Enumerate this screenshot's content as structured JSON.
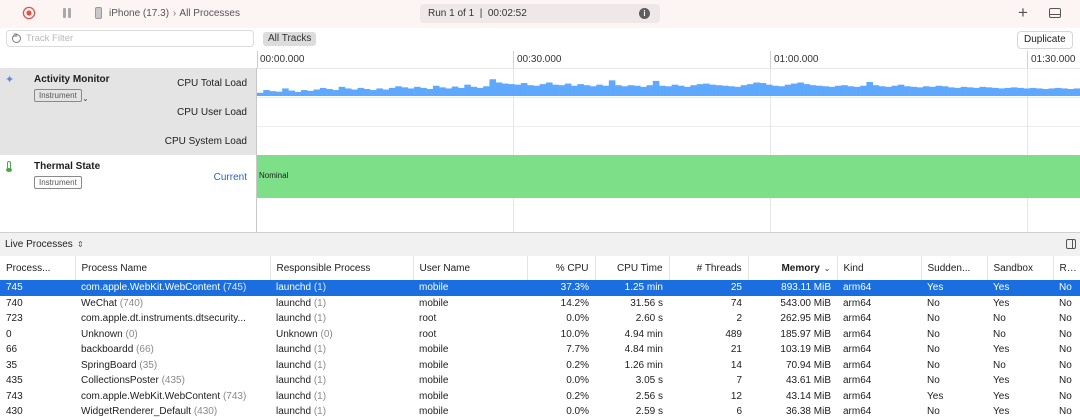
{
  "toolbar": {
    "device": "iPhone (17.3)",
    "separator": "›",
    "scope": "All Processes",
    "status": "Run 1 of 1  |  00:02:52",
    "info_icon": "info-icon",
    "plus_label": "+",
    "record_color": "#e0534b"
  },
  "filter": {
    "placeholder": "Track Filter",
    "value": "",
    "all_tracks": "All Tracks",
    "duplicate": "Duplicate"
  },
  "ruler": {
    "labels": [
      "00:00.000",
      "00:30.000",
      "01:00.000",
      "01:30.000"
    ]
  },
  "tracks": {
    "activity_monitor": {
      "title": "Activity Monitor",
      "tag": "Instrument",
      "lanes": [
        "CPU Total Load",
        "CPU User Load",
        "CPU System Load"
      ]
    },
    "thermal_state": {
      "title": "Thermal State",
      "tag": "Instrument",
      "current": "Current",
      "value": "Nominal",
      "color": "#7ddf88"
    }
  },
  "cpu_total_load": {
    "color": "#5ea8ff",
    "levels": [
      0.12,
      0.22,
      0.18,
      0.16,
      0.28,
      0.2,
      0.15,
      0.22,
      0.19,
      0.24,
      0.3,
      0.26,
      0.22,
      0.34,
      0.28,
      0.24,
      0.3,
      0.26,
      0.22,
      0.28,
      0.24,
      0.3,
      0.36,
      0.32,
      0.28,
      0.34,
      0.3,
      0.26,
      0.38,
      0.32,
      0.28,
      0.35,
      0.3,
      0.42,
      0.34,
      0.3,
      0.36,
      0.62,
      0.5,
      0.46,
      0.44,
      0.42,
      0.48,
      0.4,
      0.38,
      0.44,
      0.5,
      0.42,
      0.4,
      0.46,
      0.38,
      0.44,
      0.4,
      0.36,
      0.42,
      0.38,
      0.58,
      0.4,
      0.36,
      0.4,
      0.38,
      0.34,
      0.4,
      0.56,
      0.38,
      0.36,
      0.42,
      0.38,
      0.34,
      0.4,
      0.44,
      0.46,
      0.42,
      0.4,
      0.38,
      0.36,
      0.34,
      0.4,
      0.44,
      0.5,
      0.48,
      0.42,
      0.38,
      0.36,
      0.42,
      0.46,
      0.5,
      0.44,
      0.4,
      0.38,
      0.36,
      0.34,
      0.38,
      0.4,
      0.36,
      0.34,
      0.38,
      0.52,
      0.4,
      0.36,
      0.34,
      0.38,
      0.42,
      0.36,
      0.34,
      0.32,
      0.36,
      0.34,
      0.38,
      0.36,
      0.32,
      0.3,
      0.34,
      0.32,
      0.3,
      0.34,
      0.32,
      0.3,
      0.28,
      0.3,
      0.32,
      0.3,
      0.28,
      0.3,
      0.28,
      0.26,
      0.28,
      0.3,
      0.28,
      0.26,
      0.28
    ]
  },
  "live_processes": {
    "title": "Live Processes",
    "columns": {
      "pid": "Process...",
      "name": "Process Name",
      "responsible": "Responsible Process",
      "user": "User Name",
      "cpu": "% CPU",
      "cpu_time": "CPU Time",
      "threads": "# Threads",
      "memory": "Memory",
      "kind": "Kind",
      "sudden": "Sudden...",
      "sandbox": "Sandbox",
      "restricted": "Rest"
    },
    "rows": [
      {
        "pid": "745",
        "name": "com.apple.WebKit.WebContent",
        "name_pid": "(745)",
        "resp": "launchd",
        "resp_pid": "(1)",
        "user": "mobile",
        "cpu": "37.3%",
        "cpu_time": "1.25 min",
        "threads": "25",
        "memory": "893.11 MiB",
        "kind": "arm64",
        "sudden": "Yes",
        "sandbox": "Yes",
        "rest": "No",
        "selected": true
      },
      {
        "pid": "740",
        "name": "WeChat",
        "name_pid": "(740)",
        "resp": "launchd",
        "resp_pid": "(1)",
        "user": "mobile",
        "cpu": "14.2%",
        "cpu_time": "31.56 s",
        "threads": "74",
        "memory": "543.00 MiB",
        "kind": "arm64",
        "sudden": "No",
        "sandbox": "Yes",
        "rest": "No"
      },
      {
        "pid": "723",
        "name": "com.apple.dt.instruments.dtsecurity...",
        "name_pid": "",
        "resp": "launchd",
        "resp_pid": "(1)",
        "user": "root",
        "cpu": "0.0%",
        "cpu_time": "2.60 s",
        "threads": "2",
        "memory": "262.95 MiB",
        "kind": "arm64",
        "sudden": "No",
        "sandbox": "No",
        "rest": "No"
      },
      {
        "pid": "0",
        "name": "Unknown",
        "name_pid": "(0)",
        "resp": "Unknown",
        "resp_pid": "(0)",
        "user": "root",
        "cpu": "10.0%",
        "cpu_time": "4.94 min",
        "threads": "489",
        "memory": "185.97 MiB",
        "kind": "arm64",
        "sudden": "No",
        "sandbox": "No",
        "rest": "No"
      },
      {
        "pid": "66",
        "name": "backboardd",
        "name_pid": "(66)",
        "resp": "launchd",
        "resp_pid": "(1)",
        "user": "mobile",
        "cpu": "7.7%",
        "cpu_time": "4.84 min",
        "threads": "21",
        "memory": "103.19 MiB",
        "kind": "arm64",
        "sudden": "No",
        "sandbox": "Yes",
        "rest": "No"
      },
      {
        "pid": "35",
        "name": "SpringBoard",
        "name_pid": "(35)",
        "resp": "launchd",
        "resp_pid": "(1)",
        "user": "mobile",
        "cpu": "0.2%",
        "cpu_time": "1.26 min",
        "threads": "14",
        "memory": "70.94 MiB",
        "kind": "arm64",
        "sudden": "No",
        "sandbox": "No",
        "rest": "No"
      },
      {
        "pid": "435",
        "name": "CollectionsPoster",
        "name_pid": "(435)",
        "resp": "launchd",
        "resp_pid": "(1)",
        "user": "mobile",
        "cpu": "0.0%",
        "cpu_time": "3.05 s",
        "threads": "7",
        "memory": "43.61 MiB",
        "kind": "arm64",
        "sudden": "No",
        "sandbox": "Yes",
        "rest": "No"
      },
      {
        "pid": "743",
        "name": "com.apple.WebKit.WebContent",
        "name_pid": "(743)",
        "resp": "launchd",
        "resp_pid": "(1)",
        "user": "mobile",
        "cpu": "0.2%",
        "cpu_time": "2.56 s",
        "threads": "12",
        "memory": "43.14 MiB",
        "kind": "arm64",
        "sudden": "Yes",
        "sandbox": "Yes",
        "rest": "No"
      },
      {
        "pid": "430",
        "name": "WidgetRenderer_Default",
        "name_pid": "(430)",
        "resp": "launchd",
        "resp_pid": "(1)",
        "user": "mobile",
        "cpu": "0.0%",
        "cpu_time": "2.59 s",
        "threads": "6",
        "memory": "36.38 MiB",
        "kind": "arm64",
        "sudden": "No",
        "sandbox": "Yes",
        "rest": "No"
      }
    ]
  }
}
